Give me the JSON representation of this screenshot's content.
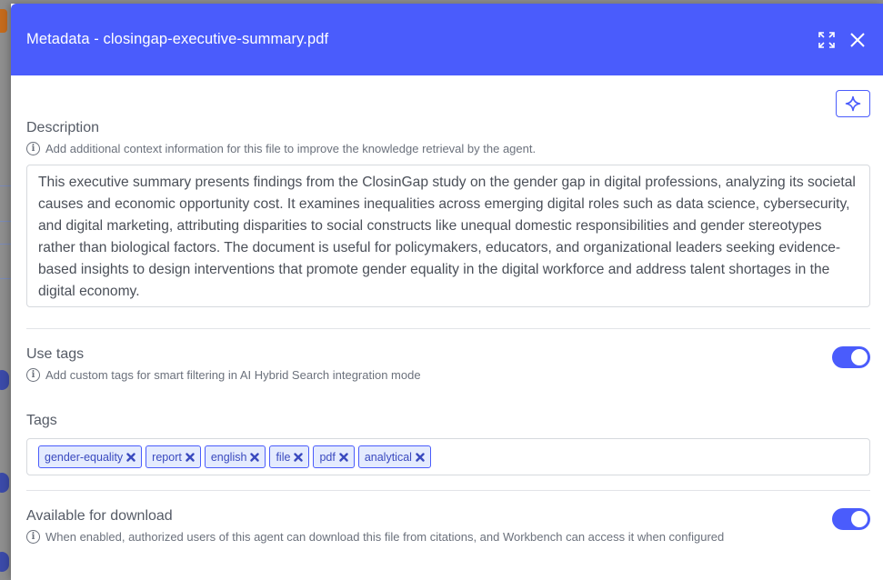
{
  "dialog": {
    "title": "Metadata - closingap-executive-summary.pdf"
  },
  "description": {
    "label": "Description",
    "hint": "Add additional context information for this file to improve the knowledge retrieval by the agent.",
    "value": "This executive summary presents findings from the ClosinGap study on the gender gap in digital professions, analyzing its societal causes and economic opportunity cost. It examines inequalities across emerging digital roles such as data science, cybersecurity, and digital marketing, attributing disparities to social constructs like unequal domestic responsibilities and gender stereotypes rather than biological factors. The document is useful for policymakers, educators, and organizational leaders seeking evidence-based insights to design interventions that promote gender equality in the digital workforce and address talent shortages in the digital economy."
  },
  "use_tags": {
    "label": "Use tags",
    "hint": "Add custom tags for smart filtering in AI Hybrid Search integration mode",
    "enabled": true
  },
  "tags": {
    "label": "Tags",
    "items": [
      "gender-equality",
      "report",
      "english",
      "file",
      "pdf",
      "analytical"
    ]
  },
  "download": {
    "label": "Available for download",
    "hint": "When enabled, authorized users of this agent can download this file from citations, and Workbench can access it when configured",
    "enabled": true
  },
  "icons": {
    "expand": "expand-icon",
    "close": "close-icon",
    "ai": "sparkle-icon",
    "info": "info-icon",
    "remove": "remove-tag-icon"
  },
  "colors": {
    "accent": "#4a5cfc",
    "tag_bg": "#e4ebfe"
  }
}
